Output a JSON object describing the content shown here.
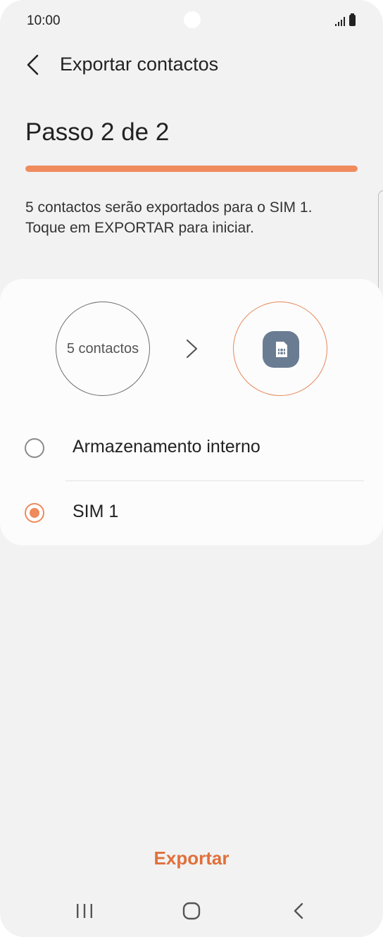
{
  "status_bar": {
    "time": "10:00"
  },
  "app_bar": {
    "title": "Exportar contactos",
    "back_icon": "back-arrow-icon"
  },
  "step": {
    "title": "Passo 2 de 2",
    "progress": 1.0
  },
  "description": {
    "line1": "5 contactos serão exportados para o SIM 1.",
    "line2": "Toque em EXPORTAR para iniciar."
  },
  "transfer": {
    "source_label": "5 contactos",
    "arrow_icon": "chevron-right-icon",
    "target_icon": "sim-card-icon"
  },
  "options": [
    {
      "label": "Armazenamento interno",
      "selected": false
    },
    {
      "label": "SIM 1",
      "selected": true
    }
  ],
  "actions": {
    "export_label": "Exportar"
  },
  "colors": {
    "accent": "#f08b5d",
    "export_text": "#e0703b",
    "sim_badge": "#6a7c92",
    "background": "#f2f2f2"
  },
  "nav_icons": [
    "recent-apps-icon",
    "home-icon",
    "back-icon"
  ]
}
